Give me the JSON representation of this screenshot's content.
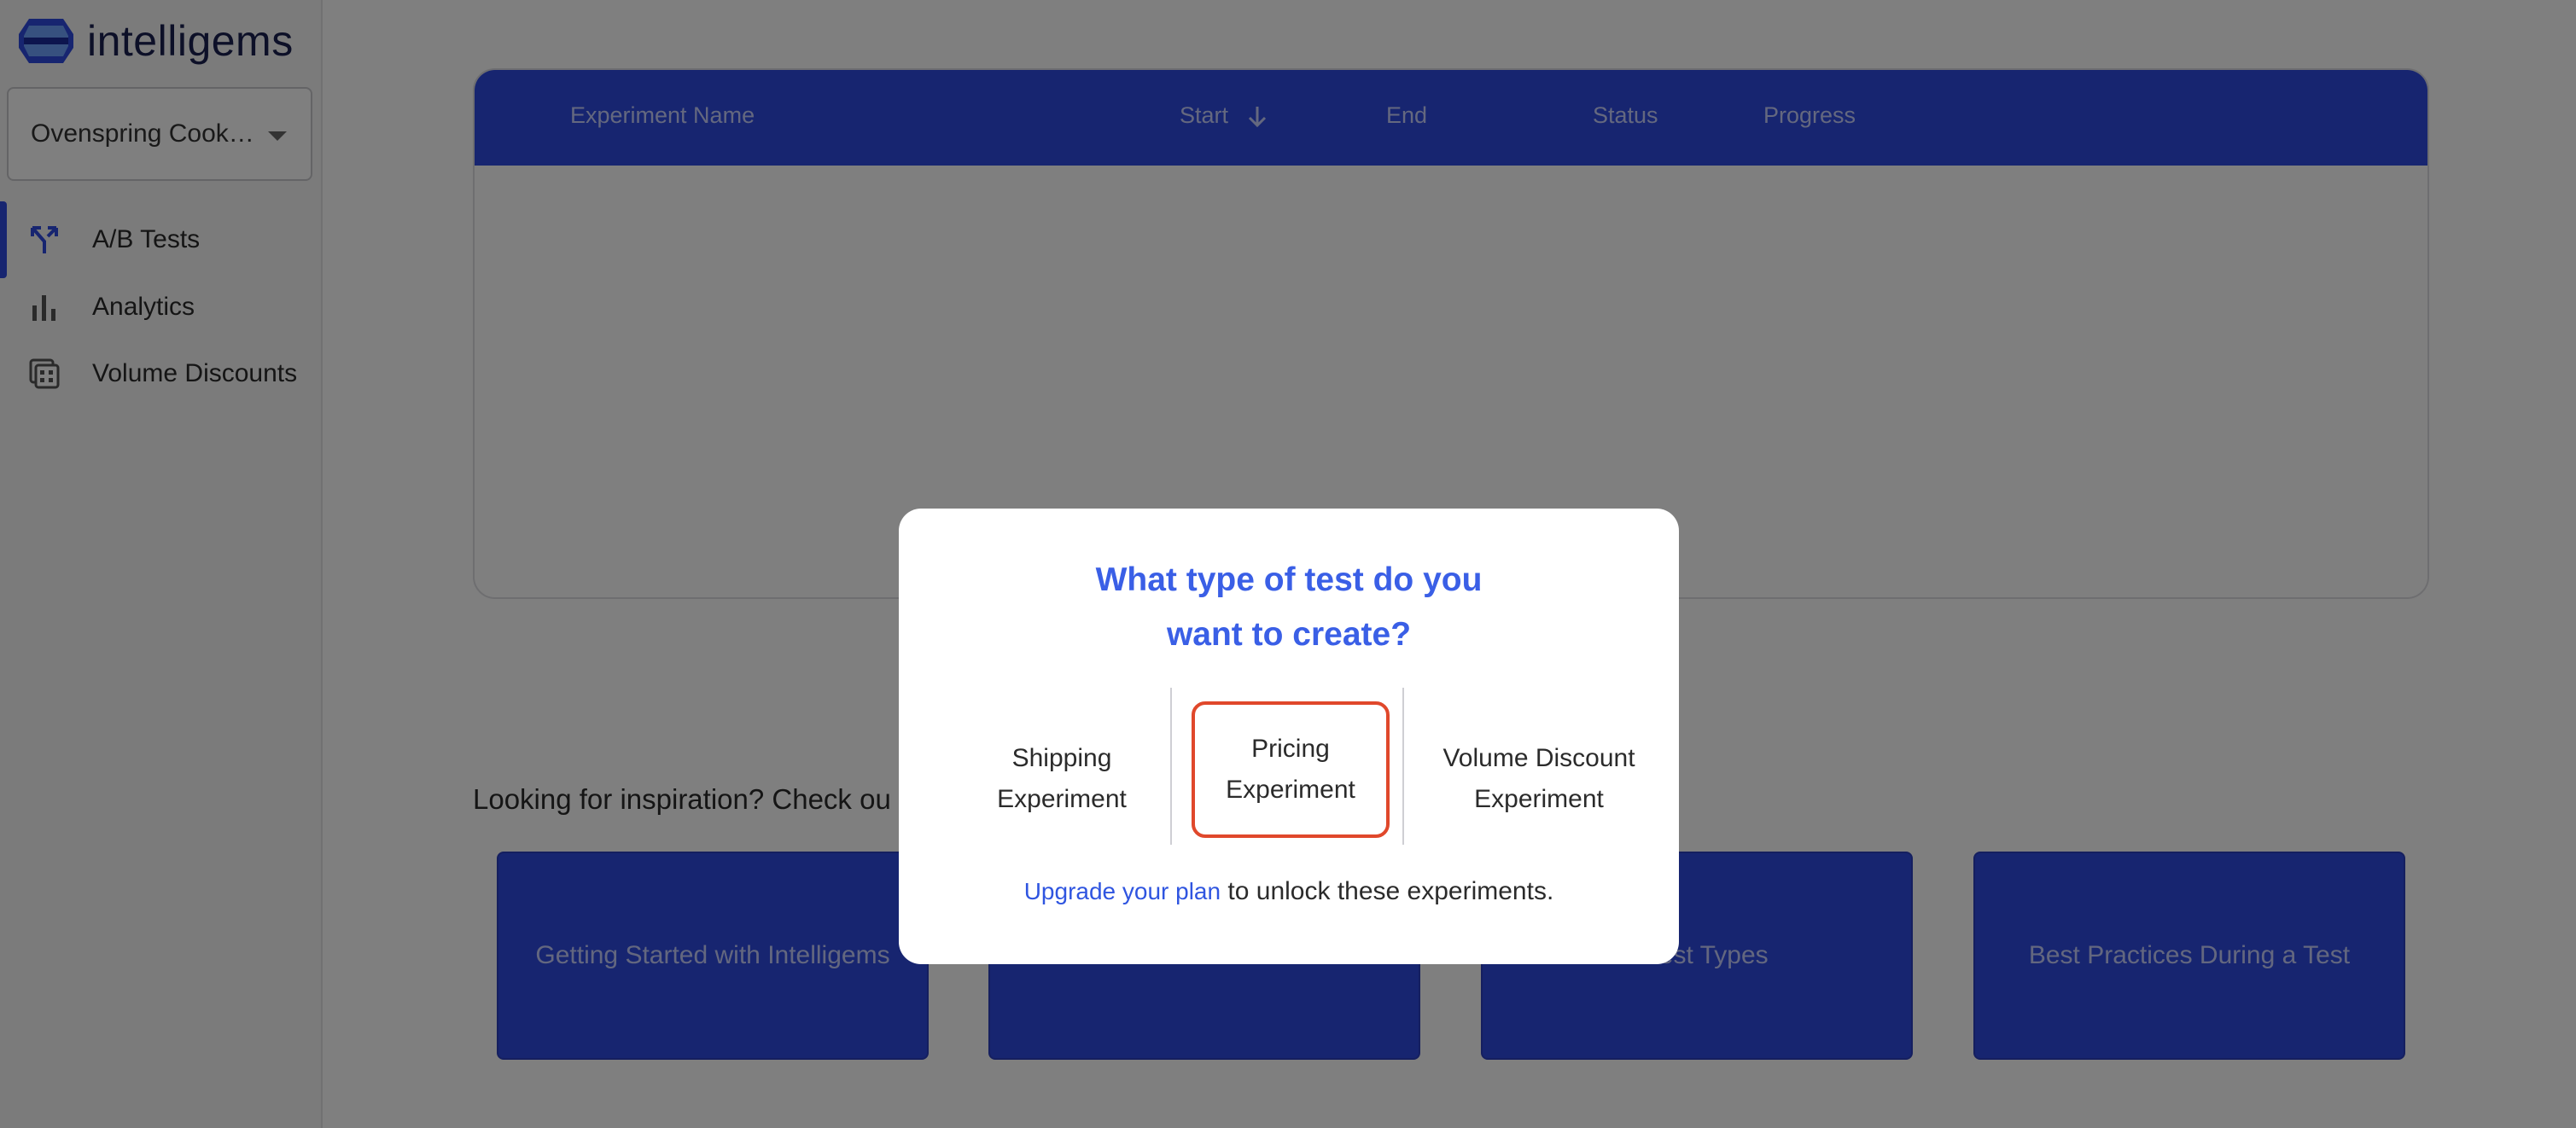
{
  "app": {
    "logo_text": "intelligems"
  },
  "sidebar": {
    "store_name": "Ovenspring Cook…",
    "items": [
      {
        "label": "A/B Tests",
        "icon": "split-arrows-icon",
        "active": true
      },
      {
        "label": "Analytics",
        "icon": "bar-chart-icon",
        "active": false
      },
      {
        "label": "Volume Discounts",
        "icon": "calculator-icon",
        "active": false
      }
    ]
  },
  "table": {
    "columns": [
      "Experiment Name",
      "Start",
      "End",
      "Status",
      "Progress"
    ],
    "sort_column": "Start",
    "rows": []
  },
  "inspiration": {
    "title": "Looking for inspiration? Check ou",
    "cards": [
      "Getting Started with Intelligems",
      "",
      "e Test Types",
      "Best Practices During a Test"
    ]
  },
  "modal": {
    "title_line1": "What type of test do you",
    "title_line2": "want to create?",
    "options": [
      {
        "line1": "Shipping",
        "line2": "Experiment",
        "selected": false
      },
      {
        "line1": "Pricing",
        "line2": "Experiment",
        "selected": true
      },
      {
        "line1": "Volume Discount",
        "line2": "Experiment",
        "selected": false
      }
    ],
    "footer_link": "Upgrade your plan",
    "footer_text": " to unlock these experiments."
  },
  "colors": {
    "primary": "#2f4be0",
    "modal_title": "#3a5fe6",
    "selected_border": "#e0482b",
    "overlay": "rgba(0,0,0,0.5)"
  }
}
